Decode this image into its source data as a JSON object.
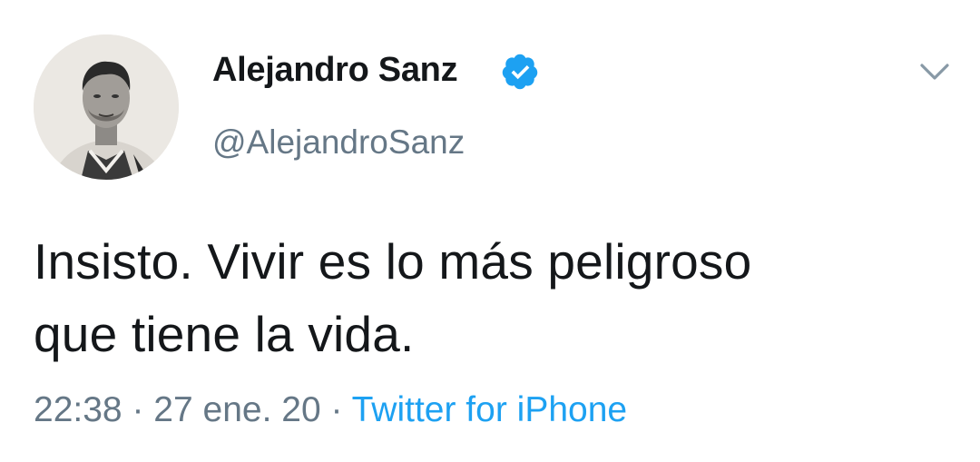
{
  "tweet": {
    "display_name": "Alejandro Sanz",
    "handle": "@AlejandroSanz",
    "verified": true,
    "text_line_1": "Insisto. Vivir es lo más peligroso",
    "text_line_2": "que tiene la vida.",
    "time": "22:38",
    "separator": "·",
    "date": "27 ene. 20",
    "source": "Twitter for iPhone"
  },
  "colors": {
    "primary_text": "#14171a",
    "secondary_text": "#657786",
    "link": "#1da1f2",
    "verified_badge": "#1da1f2",
    "background": "#ffffff"
  },
  "icons": {
    "verified": "verified-badge-icon",
    "menu": "chevron-down-icon",
    "avatar": "profile-photo"
  }
}
